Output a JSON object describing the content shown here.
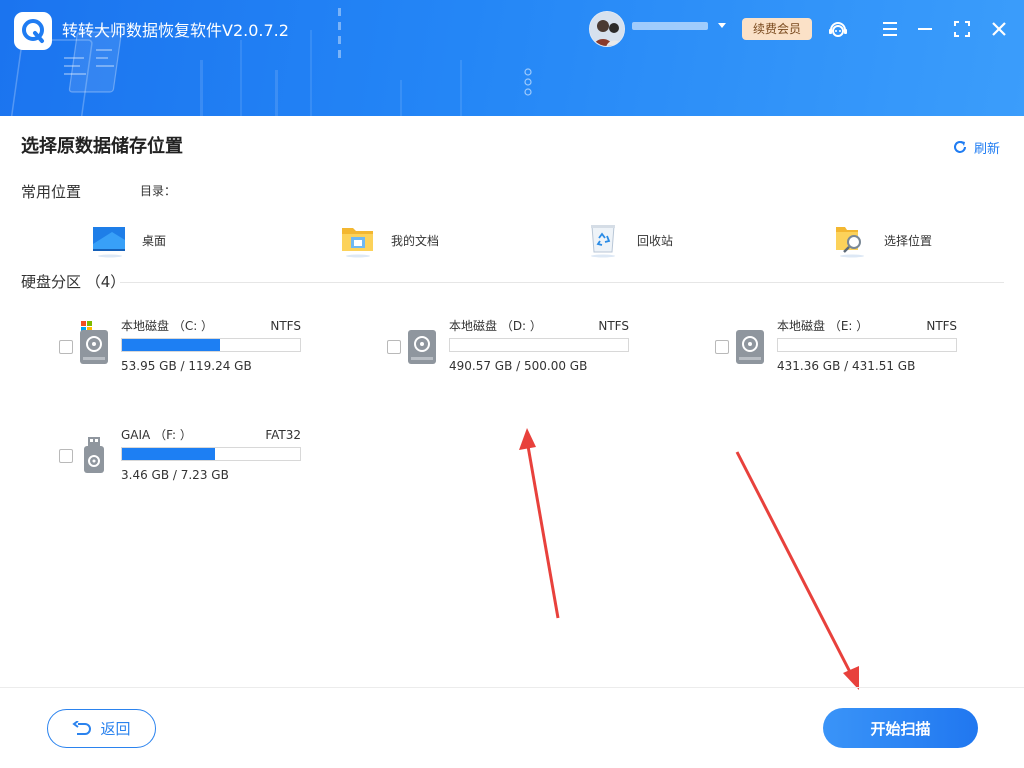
{
  "app": {
    "title": "转转大师数据恢复软件V2.0.7.2",
    "vip_label": "续费会员"
  },
  "header_icons": [
    "support-icon",
    "menu-icon",
    "minimize-icon",
    "maximize-icon",
    "close-icon"
  ],
  "page": {
    "section_title": "选择原数据储存位置",
    "refresh_label": "刷新",
    "common_label": "常用位置",
    "dir_label": "目录：",
    "disk_section_label": "硬盘分区 （4）"
  },
  "locations": [
    {
      "label": "桌面",
      "icon": "desktop-icon"
    },
    {
      "label": "我的文档",
      "icon": "documents-folder-icon"
    },
    {
      "label": "回收站",
      "icon": "recycle-bin-icon"
    },
    {
      "label": "选择位置",
      "icon": "choose-location-icon"
    }
  ],
  "drives": [
    {
      "name": "本地磁盘 （C: ）",
      "fs": "NTFS",
      "size": "53.95 GB / 119.24 GB",
      "used_fraction": 0.55,
      "system": true,
      "icon": "system-disk-icon"
    },
    {
      "name": "本地磁盘 （D: ）",
      "fs": "NTFS",
      "size": "490.57 GB / 500.00 GB",
      "used_fraction": 0.0,
      "system": false,
      "icon": "hard-disk-icon"
    },
    {
      "name": "本地磁盘 （E: ）",
      "fs": "NTFS",
      "size": "431.36 GB / 431.51 GB",
      "used_fraction": 0.0,
      "system": false,
      "icon": "hard-disk-icon"
    },
    {
      "name": "GAIA （F: ）",
      "fs": "FAT32",
      "size": "3.46 GB / 7.23 GB",
      "used_fraction": 0.52,
      "system": false,
      "icon": "usb-drive-icon"
    }
  ],
  "footer": {
    "back_label": "返回",
    "scan_label": "开始扫描"
  },
  "colors": {
    "accent": "#1f7cf2",
    "header_start": "#1b74ef",
    "header_end": "#3b9dfb",
    "bar_fill": "#1d7ff3",
    "vip_bg": "#fbe1c7",
    "annotation_arrow": "#e8413c"
  }
}
